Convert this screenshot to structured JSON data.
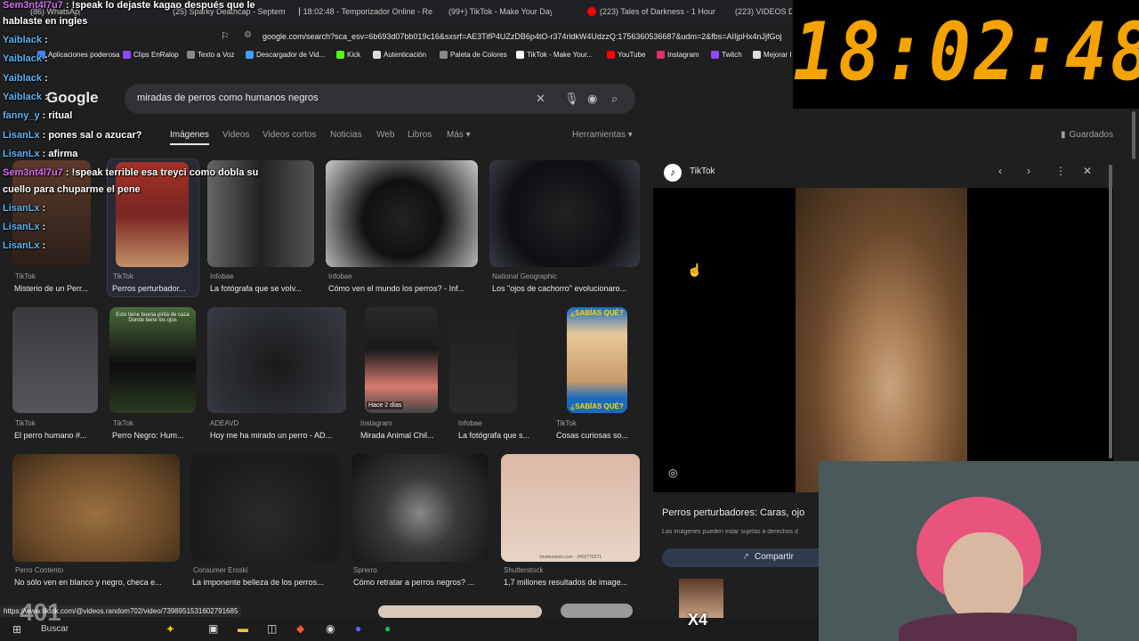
{
  "tabs": [
    {
      "label": "(86) WhatsApp",
      "color": "#25d366"
    },
    {
      "label": "(25) Sparky Deathcap - Septem",
      "color": "#ff0000"
    },
    {
      "label": "18:02:48 - Temporizador Online - Re",
      "color": "#cccccc"
    },
    {
      "label": "(99+) TikTok - Make Your Day",
      "color": "#ffffff"
    },
    {
      "label": "(223) Tales of Darkness - 1 Hour",
      "color": "#ff0000"
    },
    {
      "label": "(223) VIDEOS D",
      "color": "#ff0000"
    }
  ],
  "url": "google.com/search?sca_esv=6b693d07bb019c16&sxsrf=AE3TifP4UZzDB6p4tO-r374rldkW4UdzzQ:1756360536687&udm=2&fbs=AIIjpHx4nJjfGoj",
  "bookmarks": [
    {
      "label": "Aplicaciones poderosa",
      "color": "#4285f4"
    },
    {
      "label": "Clips EnRalop",
      "color": "#9146ff"
    },
    {
      "label": "Texto a Voz",
      "color": "#888888"
    },
    {
      "label": "Descargador de Vid...",
      "color": "#3aa0ff"
    },
    {
      "label": "Kick",
      "color": "#53fc18"
    },
    {
      "label": "Autenticación",
      "color": "#dddddd"
    },
    {
      "label": "Paleta de Colores",
      "color": "#888888"
    },
    {
      "label": "TikTok - Make Your...",
      "color": "#ffffff"
    },
    {
      "label": "YouTube",
      "color": "#ff0000"
    },
    {
      "label": "Instagram",
      "color": "#e1306c"
    },
    {
      "label": "Twitch",
      "color": "#9146ff"
    },
    {
      "label": "Mejorar I",
      "color": "#dddddd"
    }
  ],
  "google_logo": "Google",
  "search_query": "miradas de perros como humanos negros",
  "nav_tabs": [
    "Imágenes",
    "Videos",
    "Videos cortos",
    "Noticias",
    "Web",
    "Libros",
    "Más",
    "Herramientas"
  ],
  "saved_label": "Guardados",
  "clock": "18:02:48",
  "results": [
    {
      "source": "TikTok",
      "title": "Misterio de un Perr..."
    },
    {
      "source": "TikTok",
      "title": "Perros perturbador..."
    },
    {
      "source": "Infobae",
      "title": "La fotógrafa que se volv..."
    },
    {
      "source": "Infobae",
      "title": "Cómo ven el mundo los perros? - Inf..."
    },
    {
      "source": "National Geographic",
      "title": "Los \"ojos de cachorro\" evolucionaro..."
    },
    {
      "source": "TikTok",
      "title": "El perro humano #..."
    },
    {
      "source": "TikTok",
      "title": "Perro Negro: Hum..."
    },
    {
      "source": "ADEAVD",
      "title": "Hoy me ha mirado un perro - AD..."
    },
    {
      "source": "Instagram",
      "title": "Mirada Animal Chil..."
    },
    {
      "source": "Infobae",
      "title": "La fotógrafa que s..."
    },
    {
      "source": "TikTok",
      "title": "Cosas curiosas so..."
    },
    {
      "source": "Perro Contento",
      "title": "No sólo ven en blanco y negro, checa e..."
    },
    {
      "source": "Consumer Eroski",
      "title": "La imponente belleza de los perros..."
    },
    {
      "source": "Sprerro",
      "title": "Cómo retratar a perros negros? ..."
    },
    {
      "source": "Shutterstock",
      "title": "1,7 millones resultados de image..."
    }
  ],
  "badge_days": "Hace 2 días",
  "sabias": "¿SABÍAS QUÉ?",
  "thumb_overlay_text": "Esto tiene buena pinta de caza Donde tiene los ojos",
  "shutterstock_id": "shutterstock.com · 2402770271",
  "panel": {
    "source": "TikTok",
    "title": "Perros perturbadores: Caras, ojo",
    "note": "Las imágenes pueden estar sujetas a derechos d",
    "share": "Compartir"
  },
  "status_url": "https://www.tiktok.com/@videos.random702/video/7398951531602791685",
  "chat": [
    {
      "user": "Sem3nt4l7u7",
      "text": " : !speak lo dejaste kagao después que le",
      "cls": "u2"
    },
    {
      "user": "",
      "text": "hablaste en ingles",
      "cls": ""
    },
    {
      "user": "Yaiblack",
      "text": " :",
      "cls": "u"
    },
    {
      "user": "Yaiblack",
      "text": " :",
      "cls": "u"
    },
    {
      "user": "Yaiblack",
      "text": " :",
      "cls": "u"
    },
    {
      "user": "Yaiblack",
      "text": " :",
      "cls": "u"
    },
    {
      "user": "fanny_y",
      "text": " : ritual",
      "cls": "u"
    },
    {
      "user": "LisanLx",
      "text": " : pones sal o azucar?",
      "cls": "u"
    },
    {
      "user": "LisanLx",
      "text": " : afirma",
      "cls": "u"
    },
    {
      "user": "Sem3nt4l7u7",
      "text": " : !speak terrible esa treyci como dobla su",
      "cls": "u2"
    },
    {
      "user": "",
      "text": "cuello para chuparme el pene",
      "cls": ""
    },
    {
      "user": "LisanLx",
      "text": " :",
      "cls": "u"
    },
    {
      "user": "LisanLx",
      "text": " :",
      "cls": "u"
    },
    {
      "user": "LisanLx",
      "text": " :",
      "cls": "u"
    }
  ],
  "taskbar_search": "Buscar",
  "overlay_count": "401",
  "emote_multiplier": "X4"
}
